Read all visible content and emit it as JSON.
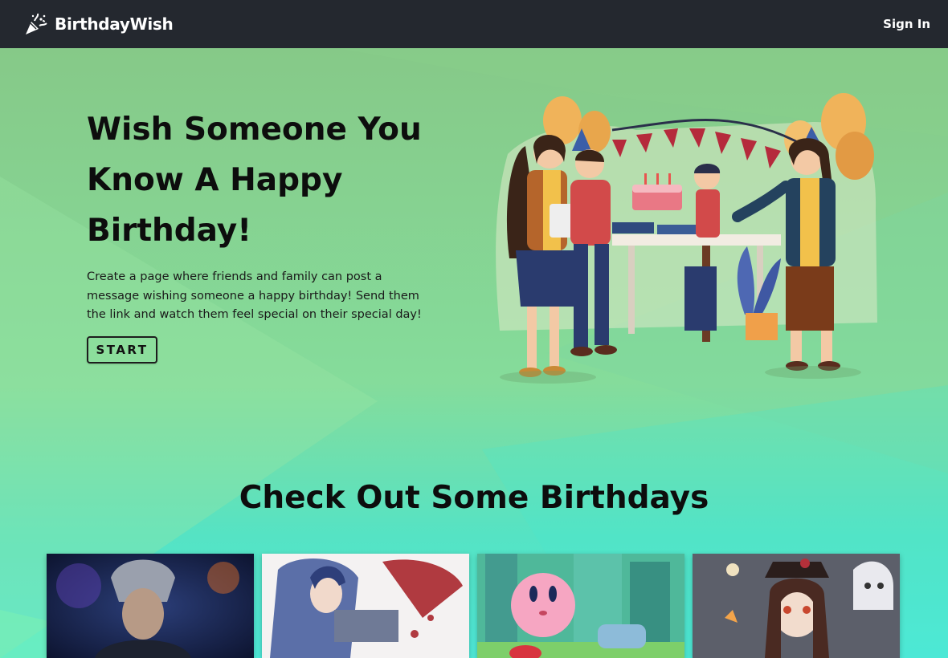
{
  "navbar": {
    "brand": "BirthdayWish",
    "brand_icon": "party-popper-icon",
    "signin_label": "Sign In"
  },
  "hero": {
    "title": "Wish Someone You Know A Happy Birthday!",
    "description": "Create a page where friends and family can post a message wishing someone a happy birthday! Send them the link and watch them feel special on their special day!",
    "start_label": "START"
  },
  "section": {
    "title": "Check Out Some Birthdays"
  },
  "cards": [
    {
      "name": "silver-haired-warrior"
    },
    {
      "name": "blue-haired-swordswoman"
    },
    {
      "name": "pink-round-character-city"
    },
    {
      "name": "girl-with-hat-and-ghost"
    }
  ],
  "colors": {
    "navbar_bg": "#24282f",
    "bg_top": "#86c988",
    "bg_bottom": "#4ee9d8"
  }
}
